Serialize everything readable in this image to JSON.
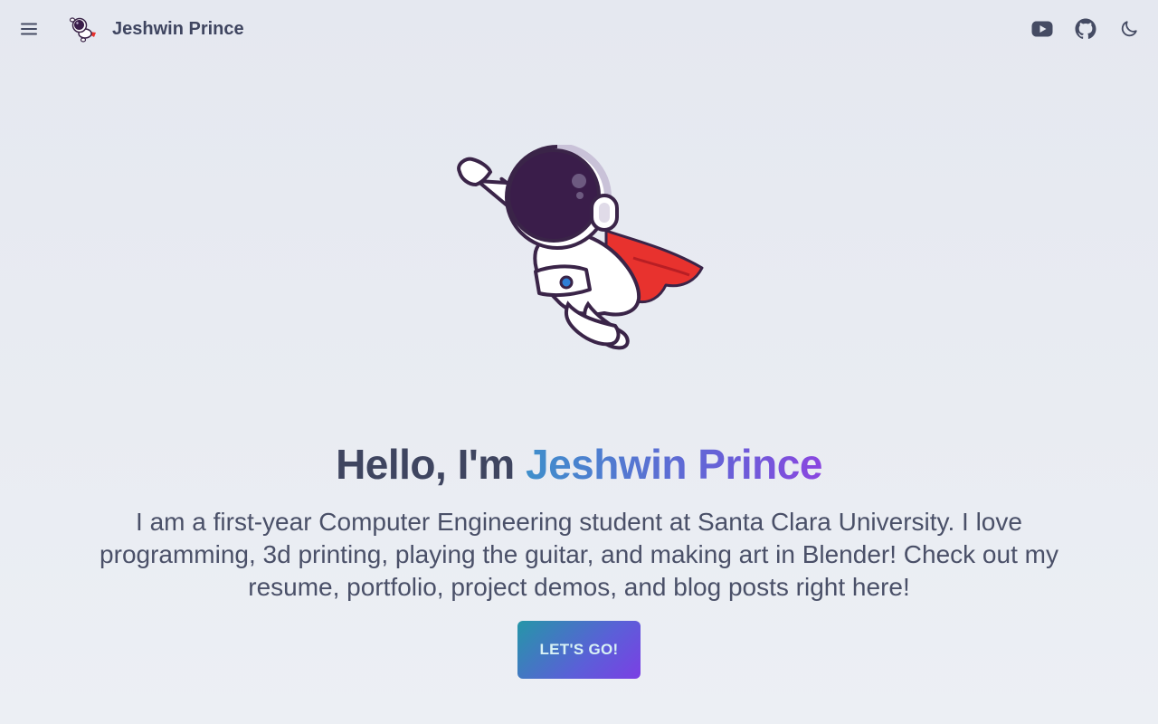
{
  "navbar": {
    "brand_title": "Jeshwin Prince",
    "menu_icon": "hamburger-menu-icon",
    "logo_icon": "astronaut-logo-icon",
    "right_icons": [
      "youtube-icon",
      "github-icon",
      "moon-icon"
    ]
  },
  "hero": {
    "image_icon": "flying-astronaut-illustration",
    "greeting": "Hello, I'm ",
    "name": "Jeshwin Prince",
    "intro": "I am a first-year Computer Engineering student at Santa Clara University. I love programming, 3d printing, playing the guitar, and making art in Blender! Check out my resume, portfolio, project demos, and blog posts right here!",
    "cta_label": "LET'S GO!"
  },
  "colors": {
    "text": "#454b63",
    "gradient_start": "#3f8fcb",
    "gradient_end": "#8a46e0",
    "button_start": "#2596a8",
    "button_end": "#7b3fe4",
    "cape": "#e8322e"
  }
}
